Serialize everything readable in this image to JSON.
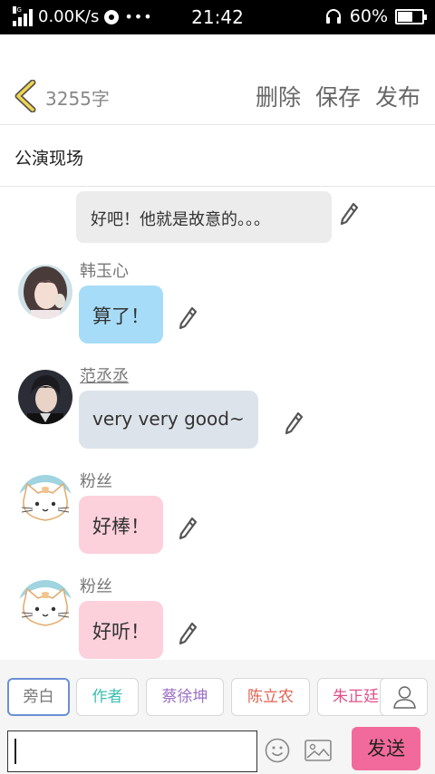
{
  "status_bar": {
    "network_tag": "4G",
    "speed": "0.00K/s",
    "time": "21:42",
    "battery_percent": "60%",
    "battery_level": 0.6
  },
  "header": {
    "word_count": "3255字",
    "delete_label": "删除",
    "save_label": "保存",
    "publish_label": "发布"
  },
  "title": "公演现场",
  "narration": {
    "text": "好吧！他就是故意的。。。"
  },
  "messages": [
    {
      "name": "韩玉心",
      "text": "算了！",
      "bubble_color": "#a6dcf7",
      "avatar": "photo-avatar-girl"
    },
    {
      "name": "范丞丞",
      "text": "very  very  good~",
      "bubble_color": "#dde3ea",
      "avatar": "photo-avatar-boy"
    },
    {
      "name": "粉丝",
      "text": "好棒！",
      "bubble_color": "#fcd1dc",
      "avatar": "cat-avatar"
    },
    {
      "name": "粉丝",
      "text": "好听！",
      "bubble_color": "#fcd1dc",
      "avatar": "cat-avatar"
    }
  ],
  "roles": [
    {
      "label": "旁白",
      "color": "#777777"
    },
    {
      "label": "作者",
      "color": "#3bbfb0"
    },
    {
      "label": "蔡徐坤",
      "color": "#9b6fc4"
    },
    {
      "label": "陈立农",
      "color": "#e06050"
    },
    {
      "label": "朱正廷",
      "color": "#e0508a"
    }
  ],
  "input": {
    "placeholder": "",
    "value": ""
  },
  "send_label": "发送",
  "colors": {
    "send_button": "#f26a9b",
    "accent_back": "#f2d64b"
  }
}
